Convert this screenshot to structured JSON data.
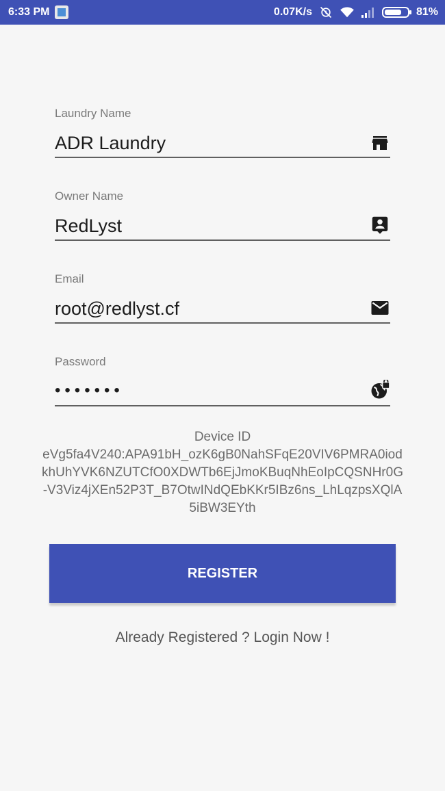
{
  "status_bar": {
    "time": "6:33 PM",
    "network_speed": "0.07K/s",
    "battery_percent": "81%",
    "battery_level": 0.81
  },
  "form": {
    "laundry_name": {
      "label": "Laundry Name",
      "value": "ADR Laundry",
      "icon": "store-icon"
    },
    "owner_name": {
      "label": "Owner Name",
      "value": "RedLyst",
      "icon": "contact-icon"
    },
    "email": {
      "label": "Email",
      "value": "root@redlyst.cf",
      "icon": "email-icon"
    },
    "password": {
      "label": "Password",
      "value": "•••••••",
      "icon": "globe-lock-icon"
    }
  },
  "device": {
    "title": "Device ID",
    "id": "eVg5fa4V240:APA91bH_ozK6gB0NahSFqE20VIV6PMRA0iodkhUhYVK6NZUTCfO0XDWTb6EjJmoKBuqNhEoIpCQSNHr0G-V3Viz4jXEn52P3T_B7OtwINdQEbKKr5IBz6ns_LhLqzpsXQlA5iBW3EYth"
  },
  "actions": {
    "register_label": "REGISTER",
    "login_link": "Already Registered ? Login Now !"
  },
  "colors": {
    "accent": "#3f51b5",
    "background": "#f6f6f6"
  }
}
